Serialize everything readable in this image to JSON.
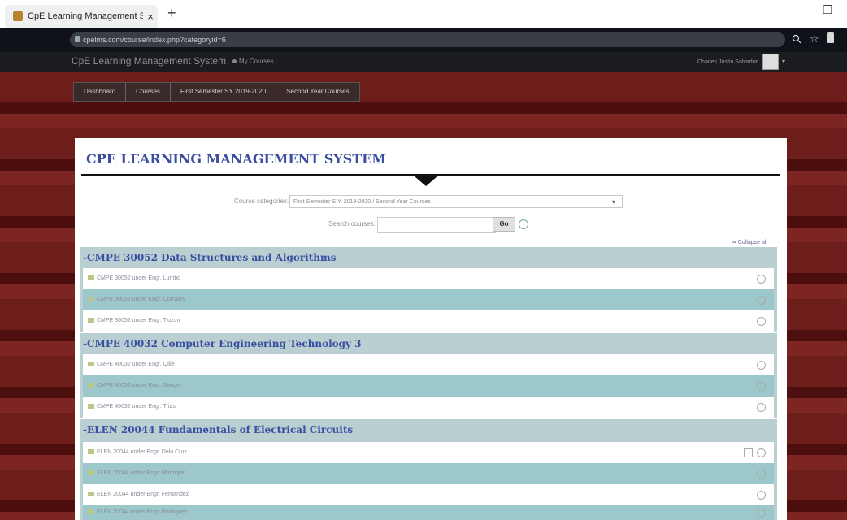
{
  "browser": {
    "tab_title": "CpE Learning Management Syste",
    "tab_close": "×",
    "new_tab": "+",
    "minimize": "–",
    "maximize": "❐",
    "url": "cpelms.com/course/index.php?categoryid=6"
  },
  "navbar": {
    "brand": "CpE Learning Management System",
    "my_courses": "My Courses",
    "user_name": "Charles Justin Salvador",
    "caret": "▾"
  },
  "breadcrumb": [
    "Dashboard",
    "Courses",
    "First Semester SY 2019-2020",
    "Second Year Courses"
  ],
  "page": {
    "title": "CPE LEARNING MANAGEMENT SYSTEM",
    "category_label": "Course categories:",
    "category_value": "First Semester S.Y. 2019-2020 / Second Year Courses",
    "search_label": "Search courses:",
    "search_value": "",
    "go_label": "Go",
    "collapse_all": "Collapse all"
  },
  "categories": [
    {
      "name": "CMPE 30052 Data Structures and Algorithms",
      "courses": [
        "CMPE 30052 under Engr. Lumbo",
        "CMPE 30052 under Engr. Corrales",
        "CMPE 30052 under Engr. Tiozon"
      ]
    },
    {
      "name": "CMPE 40032 Computer Engineering Technology 3",
      "courses": [
        "CMPE 40032 under Engr. Ollie",
        "CMPE 40032 under Engr. Sangel",
        "CMPE 40032 under Engr. Trias"
      ]
    },
    {
      "name": "ELEN 20044 Fundamentals of Electrical Circuits",
      "courses": [
        "ELEN 20044 under Engr. Dela Cruz",
        "ELEN 20044 under Engr. Manrique",
        "ELEN 20044 under Engr. Fernandez",
        "ELEN 20044 under Engr. Rodriguez"
      ]
    }
  ],
  "icons": {
    "favicon": "moodle-favicon",
    "lock": "lock-icon",
    "search": "search-icon",
    "star": "star-icon",
    "extension": "extension-icon",
    "info": "info-icon",
    "enrol": "enrol-key-icon",
    "course": "course-icon",
    "help": "help-icon"
  },
  "colors": {
    "accent_title": "#3a4fa0",
    "row_teal": "#9dc8cb",
    "category_bar": "#b9cfd2",
    "background": "#6a1c1a",
    "navbar": "#1b1c20"
  }
}
